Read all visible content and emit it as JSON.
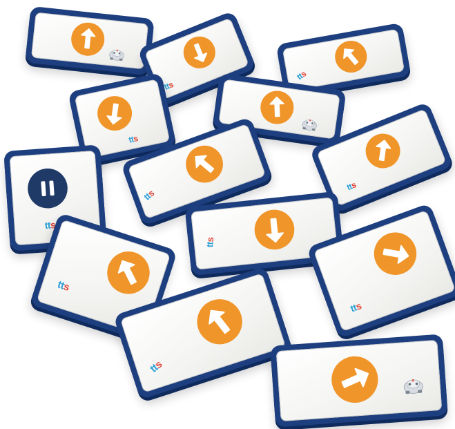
{
  "scene": {
    "tiles": [
      {
        "id": "t1",
        "badge_type": "arrow",
        "arrow_rotation": -90,
        "mark": "robot"
      },
      {
        "id": "t2",
        "badge_type": "arrow",
        "arrow_rotation": 90,
        "mark": "logo"
      },
      {
        "id": "t3",
        "badge_type": "arrow",
        "arrow_rotation": -120,
        "mark": "logo"
      },
      {
        "id": "t4",
        "badge_type": "arrow",
        "arrow_rotation": 110,
        "mark": "logo"
      },
      {
        "id": "t5",
        "badge_type": "arrow",
        "arrow_rotation": -100,
        "mark": "robot"
      },
      {
        "id": "t6",
        "badge_type": "pause",
        "arrow_rotation": 0,
        "mark": "logo"
      },
      {
        "id": "t7",
        "badge_type": "arrow",
        "arrow_rotation": -60,
        "mark": "logo"
      },
      {
        "id": "t8",
        "badge_type": "arrow",
        "arrow_rotation": -120,
        "mark": "logo"
      },
      {
        "id": "t9",
        "badge_type": "arrow",
        "arrow_rotation": 90,
        "mark": "logo"
      },
      {
        "id": "t10",
        "badge_type": "arrow",
        "arrow_rotation": -135,
        "mark": "none"
      },
      {
        "id": "t11",
        "badge_type": "arrow",
        "arrow_rotation": 30,
        "mark": "logo"
      },
      {
        "id": "t12",
        "badge_type": "arrow",
        "arrow_rotation": -110,
        "mark": "logo"
      },
      {
        "id": "t13",
        "badge_type": "arrow",
        "arrow_rotation": -20,
        "mark": "robot"
      }
    ],
    "logo_text": "tts",
    "colors": {
      "tile_edge": "#1d3f7f",
      "badge_orange": "#f0952a",
      "pause_navy": "#1f3a66",
      "logo_t": "#2a9fd6",
      "logo_s": "#e2473b"
    }
  }
}
